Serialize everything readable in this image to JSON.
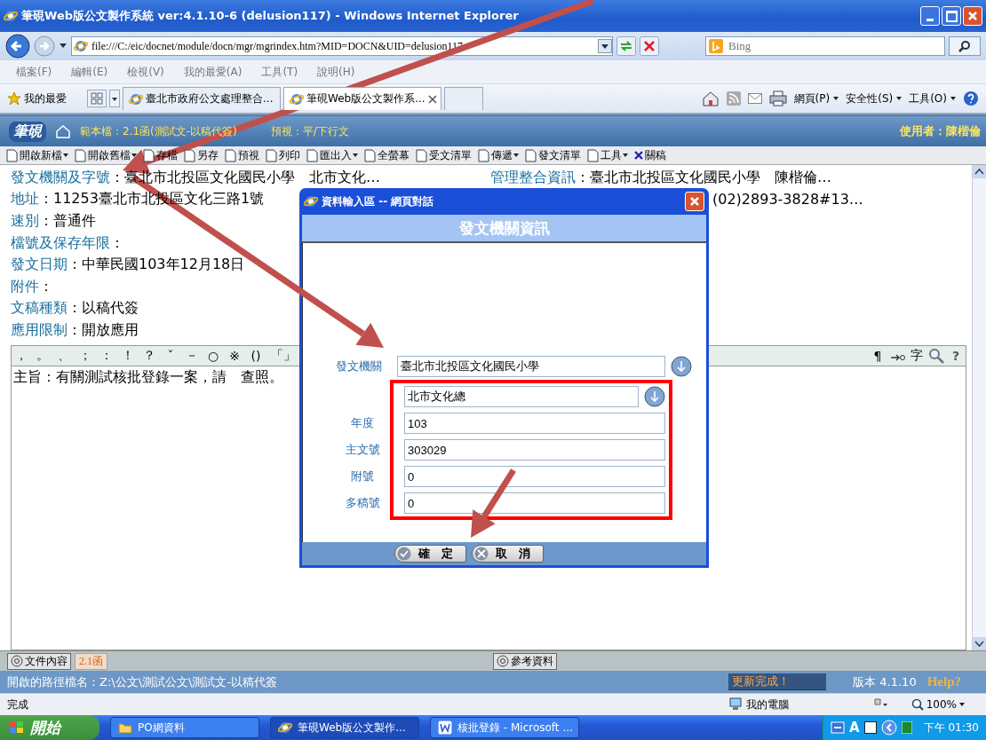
{
  "window": {
    "title": "筆硯Web版公文製作系統 ver:4.1.10-6 (delusion117) - Windows Internet Explorer"
  },
  "address_bar": {
    "url": "file:///C:/eic/docnet/module/docn/mgr/mgrindex.htm?MID=DOCN&UID=delusion117",
    "search_placeholder": "Bing"
  },
  "menu_bar": [
    "檔案(F)",
    "編輯(E)",
    "檢視(V)",
    "我的最愛(A)",
    "工具(T)",
    "說明(H)"
  ],
  "favorites_bar": {
    "favorites_label": "我的最愛",
    "tabs": [
      {
        "label": "臺北市政府公文處理整合...",
        "selected": false
      },
      {
        "label": "筆硯Web版公文製作系...",
        "selected": true
      }
    ],
    "commands": [
      "網頁(P)",
      "安全性(S)",
      "工具(O)"
    ]
  },
  "app_header": {
    "logo": "筆硯",
    "template": "範本檔：2.1函(測試文-以稿代簽)",
    "preview": "預視：平/下行文",
    "user": "使用者：陳楷倫"
  },
  "toolbar": [
    {
      "label": "開啟新檔",
      "has_menu": true
    },
    {
      "label": "開啟舊檔",
      "has_menu": true
    },
    {
      "label": "存檔",
      "has_menu": false
    },
    {
      "label": "另存",
      "has_menu": false
    },
    {
      "label": "預視",
      "has_menu": false
    },
    {
      "label": "列印",
      "has_menu": false
    },
    {
      "label": "匯出入",
      "has_menu": true
    },
    {
      "label": "全螢幕",
      "has_menu": false
    },
    {
      "label": "受文清單",
      "has_menu": false
    },
    {
      "label": "傳遞",
      "has_menu": true
    },
    {
      "label": "發文清單",
      "has_menu": false
    },
    {
      "label": "工具",
      "has_menu": true
    },
    {
      "label": "關稿",
      "has_menu": false
    }
  ],
  "document_fields": [
    {
      "label": "發文機關及字號",
      "separator": "：",
      "value": "臺北市北投區文化國民小學　北市文化…"
    },
    {
      "label": "地址",
      "separator": "：",
      "value": "11253臺北市北投區文化三路1號"
    },
    {
      "label": "速別",
      "separator": "：",
      "value": "普通件"
    },
    {
      "label": "檔號及保存年限",
      "separator": "："
    },
    {
      "label": "發文日期",
      "separator": "：",
      "value": "中華民國103年12月18日"
    },
    {
      "label": "附件",
      "separator": "："
    },
    {
      "label": "文稿種類",
      "separator": "：",
      "value": "以稿代簽"
    },
    {
      "label": "應用限制",
      "separator": "：",
      "value": "開放應用"
    }
  ],
  "side_fields": [
    {
      "label": "管理整合資訊",
      "separator": "：",
      "value": "臺北市北投區文化國民小學　陳楷倫…"
    },
    {
      "value": "(02)2893-3828#13…"
    }
  ],
  "symbol_bar": {
    "symbols": [
      "，",
      "。",
      "、",
      "；",
      "：",
      "！",
      "？",
      "ˇ",
      "－",
      "○",
      "※",
      "()",
      "「」"
    ],
    "tools": [
      "¶",
      "字",
      "?"
    ]
  },
  "editor": {
    "text": "主旨：有關測試核批登錄一案，請　查照。"
  },
  "bottom_tabs": [
    {
      "label": "文件內容",
      "kind": "button"
    },
    {
      "label": "2.1函",
      "kind": "tab"
    },
    {
      "label": "參考資料",
      "kind": "button"
    }
  ],
  "app_status": {
    "path": "開啟的路徑檔名：Z:\\公文\\測試公文\\測試文-以稿代簽",
    "message": "更新完成！",
    "version": "版本 4.1.10",
    "help": "Help?"
  },
  "browser_status": {
    "text": "完成",
    "zone": "我的電腦",
    "zoom": "100%"
  },
  "taskbar": {
    "start": "開始",
    "tasks": [
      {
        "label": "PO網資料",
        "selected": false
      },
      {
        "label": "筆硯Web版公文製作...",
        "selected": true
      },
      {
        "label": "核批登錄 - Microsoft ...",
        "selected": false
      }
    ],
    "tray_text": "A",
    "clock": "下午 01:30"
  },
  "dialog": {
    "title": "資料輸入區 -- 網頁對話",
    "heading": "發文機關資訊",
    "fields": [
      {
        "label": "發文機關",
        "value": "臺北市北投區文化國民小學",
        "lookup": true,
        "highlighted": false
      },
      {
        "value": "北市文化總",
        "lookup": true,
        "highlighted": true
      },
      {
        "label": "年度",
        "value": "103",
        "lookup": false,
        "highlighted": true
      },
      {
        "label": "主文號",
        "value": "303029",
        "lookup": false,
        "highlighted": true
      },
      {
        "label": "附號",
        "value": "0",
        "lookup": false,
        "highlighted": true
      },
      {
        "label": "多稿號",
        "value": "0",
        "lookup": false,
        "highlighted": true
      }
    ],
    "buttons": [
      {
        "label": "確　定",
        "kind": "ok"
      },
      {
        "label": "取　消",
        "kind": "cancel"
      }
    ]
  }
}
